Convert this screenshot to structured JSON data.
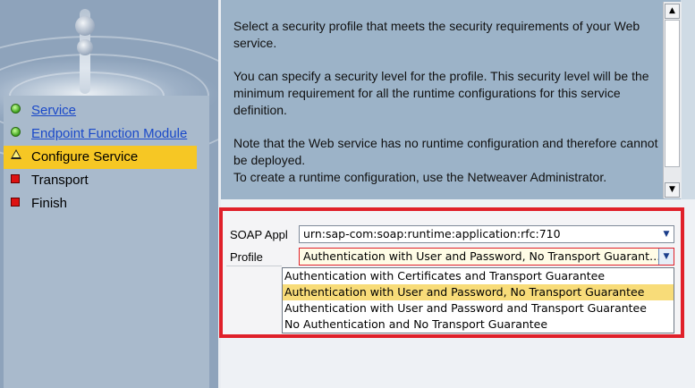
{
  "wizard": {
    "steps": [
      {
        "label": "Service",
        "state": "done",
        "icon": "green-circle-icon",
        "link": true
      },
      {
        "label": "Endpoint Function Module",
        "state": "done",
        "icon": "green-circle-icon",
        "link": true
      },
      {
        "label": "Configure Service",
        "state": "current",
        "icon": "warning-triangle-icon",
        "link": false
      },
      {
        "label": "Transport",
        "state": "todo",
        "icon": "red-square-icon",
        "link": false
      },
      {
        "label": "Finish",
        "state": "todo",
        "icon": "red-square-icon",
        "link": false
      }
    ]
  },
  "info": {
    "paragraphs": [
      "Select a security profile that meets the security requirements of your Web service.",
      "You can specify a security level for the profile. This security level will be the minimum requirement for all the runtime configurations for this service definition.",
      "Note that the Web service has no runtime configuration and therefore cannot be deployed.",
      "To create a runtime configuration, use the Netweaver Administrator."
    ]
  },
  "form": {
    "soap_label": "SOAP Appl",
    "soap_value": "urn:sap-com:soap:runtime:application:rfc:710",
    "profile_label": "Profile",
    "profile_value": "Authentication with User and Password, No Transport Guarant…",
    "profile_options": [
      "Authentication with Certificates and Transport Guarantee",
      "Authentication with User and Password, No Transport Guarantee",
      "Authentication with User and Password and Transport Guarantee",
      "No Authentication and No Transport Guarantee"
    ],
    "selected_option_index": 1
  },
  "colors": {
    "highlight": "#f6c724",
    "annotation_border": "#e0202a",
    "link": "#1a49c9"
  }
}
